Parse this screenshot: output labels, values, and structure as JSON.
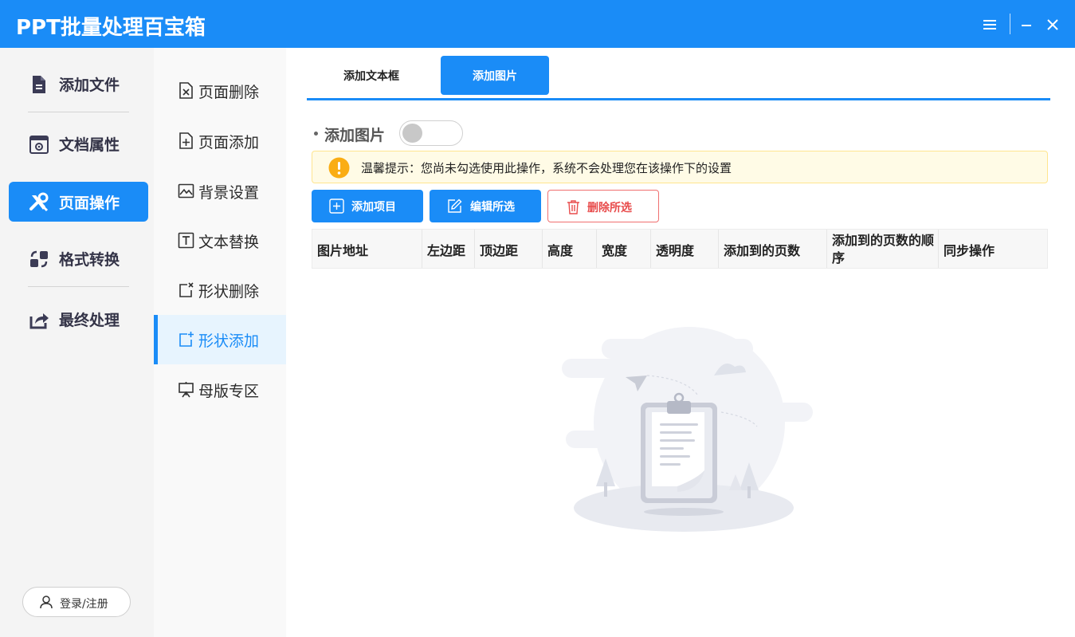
{
  "app": {
    "title": "PPT批量处理百宝箱"
  },
  "window_controls": {
    "menu_icon": "hamburger-menu-icon",
    "minimize_icon": "minimize-icon",
    "close_icon": "close-icon"
  },
  "sidebar": {
    "items": [
      {
        "label": "添加文件",
        "icon": "file-add-icon",
        "active": false
      },
      {
        "label": "文档属性",
        "icon": "document-settings-icon",
        "active": false
      },
      {
        "label": "页面操作",
        "icon": "tools-icon",
        "active": true
      },
      {
        "label": "格式转换",
        "icon": "convert-icon",
        "active": false
      },
      {
        "label": "最终处理",
        "icon": "share-export-icon",
        "active": false
      }
    ],
    "login_label": "登录/注册"
  },
  "subnav": {
    "items": [
      {
        "label": "页面删除",
        "icon": "page-delete-icon",
        "active": false
      },
      {
        "label": "页面添加",
        "icon": "page-add-icon",
        "active": false
      },
      {
        "label": "背景设置",
        "icon": "background-image-icon",
        "active": false
      },
      {
        "label": "文本替换",
        "icon": "text-replace-icon",
        "active": false
      },
      {
        "label": "形状删除",
        "icon": "shape-delete-icon",
        "active": false
      },
      {
        "label": "形状添加",
        "icon": "shape-add-icon",
        "active": true
      },
      {
        "label": "母版专区",
        "icon": "master-slide-icon",
        "active": false
      }
    ]
  },
  "main": {
    "tabs": [
      {
        "label": "添加文本框",
        "active": false
      },
      {
        "label": "添加图片",
        "active": true
      }
    ],
    "toggle_label": "添加图片",
    "toggle_on": false,
    "notice": "温馨提示：您尚未勾选使用此操作，系统不会处理您在该操作下的设置",
    "buttons": {
      "add": "添加项目",
      "edit": "编辑所选",
      "delete": "删除所选"
    },
    "table": {
      "columns": [
        "图片地址",
        "左边距",
        "顶边距",
        "高度",
        "宽度",
        "透明度",
        "添加到的页数",
        "添加到的页数的顺序",
        "同步操作"
      ],
      "rows": []
    }
  },
  "colors": {
    "accent": "#1a8cf7",
    "danger": "#e84c4c",
    "notice_bg": "#fffbe6",
    "warning": "#faad14"
  }
}
